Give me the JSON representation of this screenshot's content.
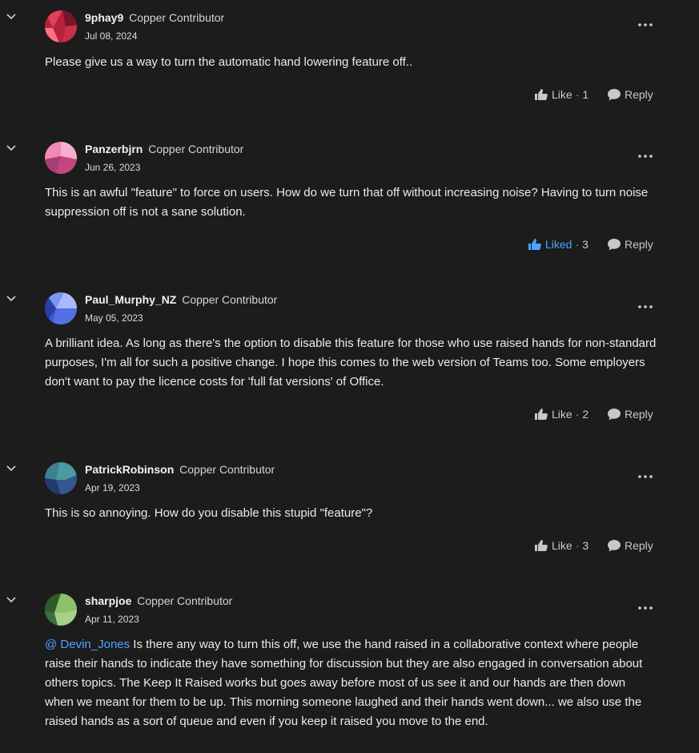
{
  "comments": [
    {
      "author": "9phay9",
      "rank": "Copper Contributor",
      "date": "Jul 08, 2024",
      "body": [
        "Please give us a way to turn the automatic hand lowering feature off.."
      ],
      "like_label": "Like",
      "like_sep": "·",
      "like_count": "1",
      "liked": false,
      "reply_label": "Reply",
      "avatar_colors": [
        "#b4223c",
        "#e0405a",
        "#7a1528",
        "#ff6f86",
        "#c93048"
      ]
    },
    {
      "author": "Panzerbjrn",
      "rank": "Copper Contributor",
      "date": "Jun 26, 2023",
      "body": [
        "This is an awful \"feature\" to force on users. How do we turn that off without increasing noise? Having to turn noise suppression off is not a sane solution."
      ],
      "like_label": "Liked",
      "like_sep": "·",
      "like_count": "3",
      "liked": true,
      "reply_label": "Reply",
      "avatar_colors": [
        "#d6538e",
        "#f089b6",
        "#a93c73",
        "#f6b0cf",
        "#c4467f"
      ]
    },
    {
      "author": "Paul_Murphy_NZ",
      "rank": "Copper Contributor",
      "date": "May 05, 2023",
      "body": [
        "A brilliant idea. As long as there's the option to disable this feature for those who use raised hands for non-standard purposes, I'm all for such a positive change. I hope this comes to the web version of Teams too. Some employers don't want to pay the licence costs for 'full fat versions' of Office."
      ],
      "like_label": "Like",
      "like_sep": "·",
      "like_count": "2",
      "liked": false,
      "reply_label": "Reply",
      "avatar_colors": [
        "#3b5bd6",
        "#7c95f2",
        "#2a3fa6",
        "#a9b9fb",
        "#5570e0"
      ]
    },
    {
      "author": "PatrickRobinson",
      "rank": "Copper Contributor",
      "date": "Apr 19, 2023",
      "body": [
        "This is so annoying. How do you disable this stupid \"feature\"?"
      ],
      "like_label": "Like",
      "like_sep": "·",
      "like_count": "3",
      "liked": false,
      "reply_label": "Reply",
      "avatar_colors": [
        "#2e4a8a",
        "#3f7f92",
        "#243a6e",
        "#4b9aa0",
        "#35578f"
      ]
    },
    {
      "author": "sharpjoe",
      "rank": "Copper Contributor",
      "date": "Apr 11, 2023",
      "mention_symbol": "@",
      "mention": "Devin_Jones",
      "body": [
        " Is there any way to turn this off, we use the hand raised in a collaborative context where people raise their hands to indicate they have something for discussion but they are also engaged in conversation about others topics.  The Keep It Raised works but goes away before most of us see it and our hands are then down when we meant for them to be up.  This morning someone laughed and their hands went down... we also use the raised hands as a sort of queue and even if you keep it raised you move to the end."
      ],
      "liked": false,
      "avatar_colors": [
        "#4a7a35",
        "#8fc06a",
        "#2f5a2a",
        "#a8d08a",
        "#3e6e46"
      ]
    }
  ],
  "icons": {
    "chevron": "chevron-down-icon",
    "more": "more-options-icon",
    "like": "thumbs-up-icon",
    "reply": "speech-bubble-icon"
  },
  "colors": {
    "background": "#1c1c1c",
    "liked": "#4ea3ff",
    "mention": "#4ea3ff"
  }
}
